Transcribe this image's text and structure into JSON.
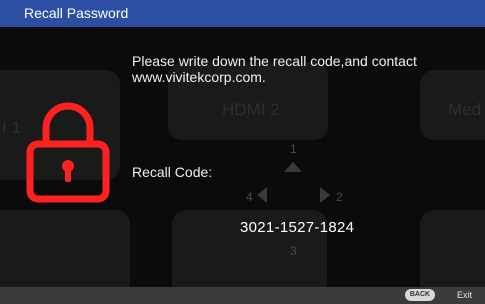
{
  "dialog": {
    "title": "Recall Password",
    "message": "Please write down the recall code,and contact www.vivitekcorp.com.",
    "recall_label": "Recall Code:",
    "recall_code": "3021-1527-1824"
  },
  "background_menu": {
    "tile_center_label": "HDMI 2",
    "tile_left_label": "I 1",
    "tile_right_label": "Med",
    "nav_numbers": [
      "1",
      "2",
      "3",
      "4"
    ]
  },
  "footer": {
    "back_label": "BACK",
    "exit_label": "Exit"
  },
  "colors": {
    "titlebar": "#2c4fa3",
    "lock": "#ff2020"
  },
  "icons": {
    "lock": "lock-icon"
  }
}
